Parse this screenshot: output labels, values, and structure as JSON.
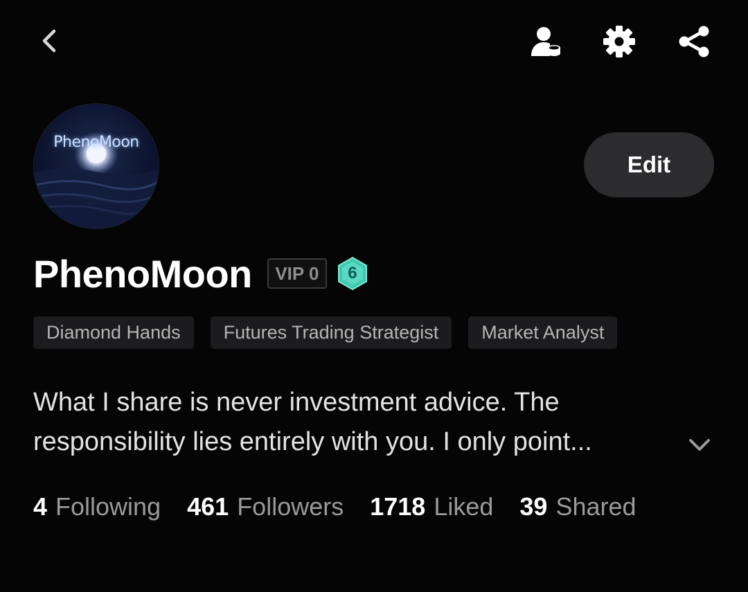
{
  "header": {
    "back_icon": "chevron-left-icon",
    "actions": [
      {
        "icon": "user-coin-icon"
      },
      {
        "icon": "gear-icon"
      },
      {
        "icon": "share-icon"
      }
    ]
  },
  "profile": {
    "avatar_text": "PhenoMoon",
    "name": "PhenoMoon",
    "vip_label": "VIP 0",
    "level": "6",
    "edit_label": "Edit",
    "tags": [
      "Diamond Hands",
      "Futures Trading Strategist",
      "Market Analyst"
    ],
    "bio_line_1": "What I share is never investment advice. The",
    "bio_line_2": "responsibility lies entirely with you. I only point..."
  },
  "stats": [
    {
      "value": "4",
      "label": "Following"
    },
    {
      "value": "461",
      "label": "Followers"
    },
    {
      "value": "1718",
      "label": "Liked"
    },
    {
      "value": "39",
      "label": "Shared"
    }
  ],
  "colors": {
    "background": "#050505",
    "level_badge": "#3ec9b0",
    "edit_button_bg": "#2c2c2e",
    "tag_bg": "#1c1c1e"
  }
}
